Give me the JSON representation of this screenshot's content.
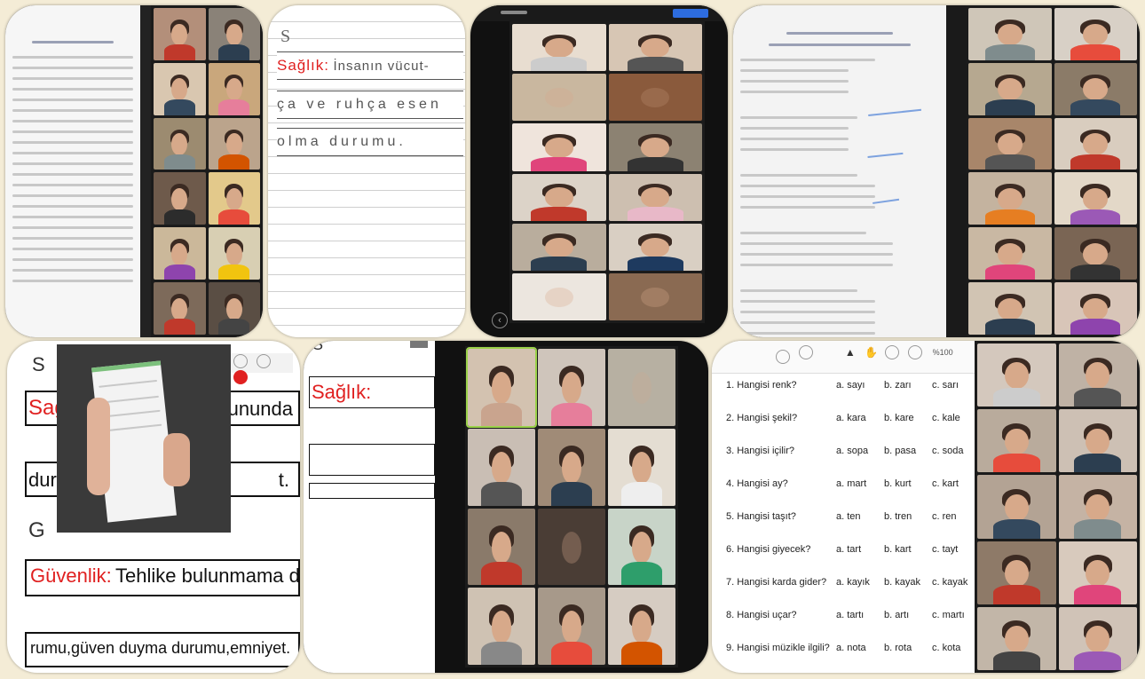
{
  "top_middle_note": {
    "letter": "S",
    "term": "Sağlık:",
    "line1": "İnsanın vücut-",
    "line2": "ça ve ruhça esen",
    "line3": "olma durumu."
  },
  "bottom_left_note": {
    "letter_top": "S",
    "term_top_partial": "Sağ",
    "partial_right_1": "ununda",
    "partial_right_2": "t.",
    "partial_left": "dur",
    "letter_bottom": "G",
    "term_bottom": "Güvenlik:",
    "line_bottom_1": "Tehlike bulunmama du-",
    "line_bottom_2": "rumu,güven duyma durumu,emniyet."
  },
  "bottom_middle_note": {
    "letter": "S",
    "term": "Sağlık:"
  },
  "quiz": {
    "zoom_label": "%100",
    "rows": [
      {
        "q": "1. Hangisi renk?",
        "a": "a. sayı",
        "b": "b. zarı",
        "c": "c. sarı"
      },
      {
        "q": "2. Hangisi şekil?",
        "a": "a. kara",
        "b": "b. kare",
        "c": "c. kale"
      },
      {
        "q": "3. Hangisi içilir?",
        "a": "a. sopa",
        "b": "b. pasa",
        "c": "c. soda"
      },
      {
        "q": "4. Hangisi ay?",
        "a": "a. mart",
        "b": "b. kurt",
        "c": "c. kart"
      },
      {
        "q": "5. Hangisi taşıt?",
        "a": "a. ten",
        "b": "b. tren",
        "c": "c. ren"
      },
      {
        "q": "6. Hangisi giyecek?",
        "a": "a. tart",
        "b": "b. kart",
        "c": "c. tayt"
      },
      {
        "q": "7. Hangisi karda gider?",
        "a": "a. kayık",
        "b": "b. kayak",
        "c": "c. kayak"
      },
      {
        "q": "8. Hangisi uçar?",
        "a": "a. tartı",
        "b": "b. artı",
        "c": "c. martı"
      },
      {
        "q": "9. Hangisi müzikle ilgili?",
        "a": "a. nota",
        "b": "b. rota",
        "c": "c. kota"
      }
    ]
  },
  "colors": {
    "background": "#f4ecd6",
    "accent_red": "#e02020",
    "video_grid_bg": "#1b1b1b"
  }
}
